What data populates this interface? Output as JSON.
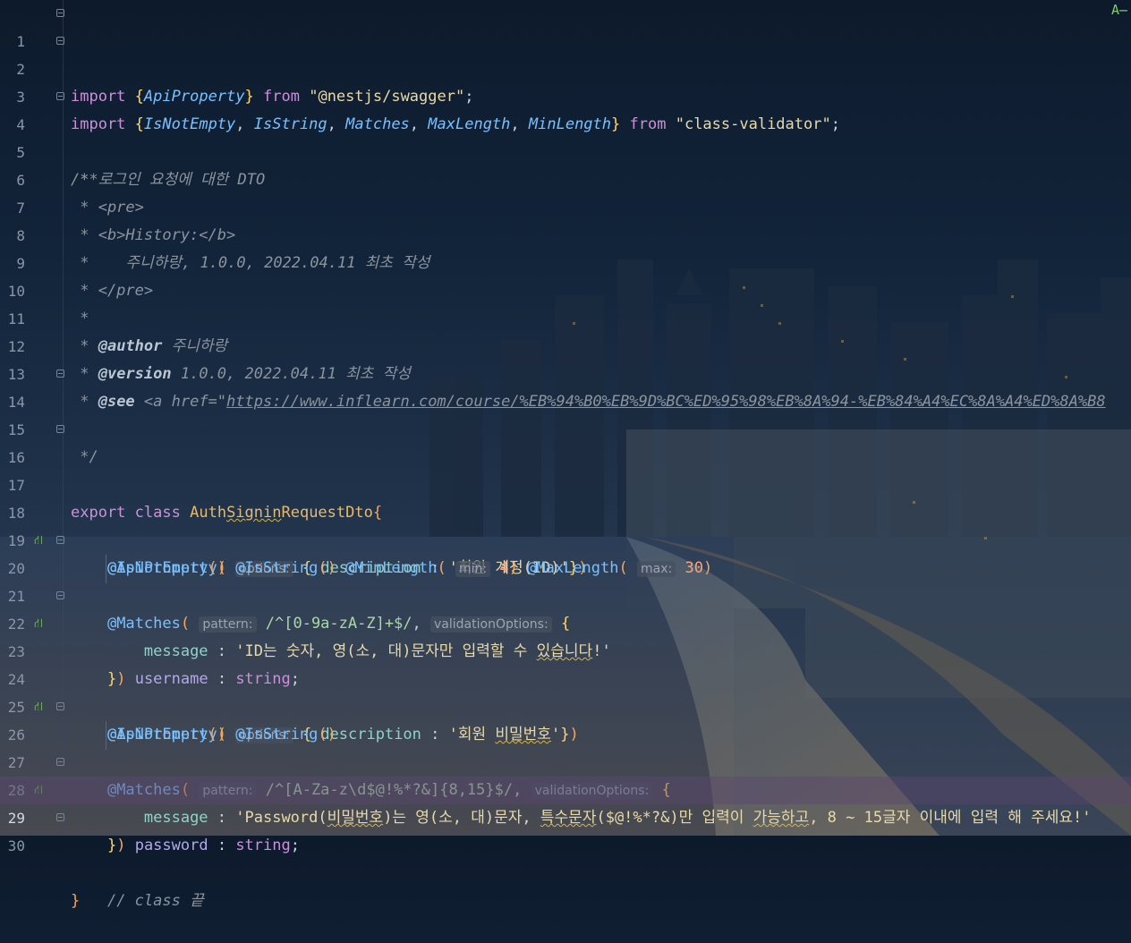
{
  "editor": {
    "corner_indicator": "A̶",
    "inspection_icon": "⛙",
    "lines": [
      {
        "n": "1",
        "text": "import {ApiProperty} from \"@nestjs/swagger\";"
      },
      {
        "n": "2",
        "text": "import {IsNotEmpty, IsString, Matches, MaxLength, MinLength} from \"class-validator\";"
      },
      {
        "n": "3",
        "text": ""
      },
      {
        "n": "4",
        "text": "/**"
      },
      {
        "n": "5",
        "text": " * 로그인 요청에 대한 DTO"
      },
      {
        "n": "6",
        "text": " * <pre>"
      },
      {
        "n": "7",
        "text": " * <b>History:</b>"
      },
      {
        "n": "8",
        "text": " *    주니하랑, 1.0.0, 2022.04.11 최초 작성"
      },
      {
        "n": "9",
        "text": " * </pre>"
      },
      {
        "n": "10",
        "text": " *"
      },
      {
        "n": "11",
        "text": " * @author 주니하랑"
      },
      {
        "n": "12",
        "text": " * @version 1.0.0, 2022.04.11 최초 작성"
      },
      {
        "n": "13",
        "text": " * @see <a href=\"https://www.inflearn.com/course/%EB%94%B0%EB%9D%BC%ED%95%98%EB%8A%94-%EB%84%A4%EC%8A%A4%ED%8A%B8"
      },
      {
        "n": "14",
        "text": " */"
      },
      {
        "n": "15",
        "text": ""
      },
      {
        "n": "16",
        "text": "export class AuthSigninRequestDto{"
      },
      {
        "n": "17",
        "text": ""
      },
      {
        "n": "18",
        "text": "@ApiProperty( options: { description : '회원 계정(ID)'})"
      },
      {
        "n": "19",
        "text": "@IsNotEmpty() @IsString() @MinLength( min: 4) @MaxLength( max: 30)"
      },
      {
        "n": "20",
        "text": "@Matches( pattern: /^[0-9a-zA-Z]+$/, validationOptions: {"
      },
      {
        "n": "21",
        "text": "message : 'ID는 숫자, 영(소, 대)문자만 입력할 수 있습니다!'"
      },
      {
        "n": "22",
        "text": "}) username : string;"
      },
      {
        "n": "23",
        "text": ""
      },
      {
        "n": "24",
        "text": "@ApiProperty( options: { description : '회원 비밀번호'})"
      },
      {
        "n": "25",
        "text": "@IsNotEmpty() @IsString()"
      },
      {
        "n": "26",
        "text": "@Matches( pattern: /^[A-Za-z\\d$@!%*?&]{8,15}$/, validationOptions: {"
      },
      {
        "n": "27",
        "text": "message : 'Password(비밀번호)는 영(소, 대)문자, 특수문자($@!%*?&)만 입력이 가능하고, 8 ~ 15글자 이내에 입력 해 주세요!'"
      },
      {
        "n": "28",
        "text": "}) password : string;"
      },
      {
        "n": "29",
        "text": ""
      },
      {
        "n": "30",
        "text": "}   // class 끝"
      }
    ]
  }
}
